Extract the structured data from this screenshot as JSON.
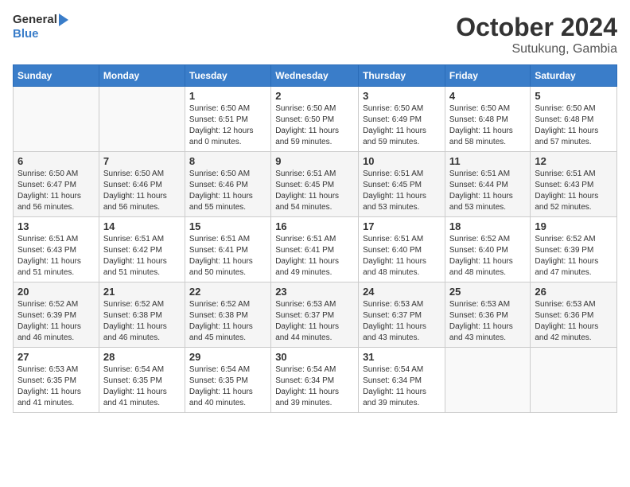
{
  "header": {
    "logo_general": "General",
    "logo_blue": "Blue",
    "month": "October 2024",
    "location": "Sutukung, Gambia"
  },
  "days_of_week": [
    "Sunday",
    "Monday",
    "Tuesday",
    "Wednesday",
    "Thursday",
    "Friday",
    "Saturday"
  ],
  "weeks": [
    [
      {
        "day": "",
        "info": ""
      },
      {
        "day": "",
        "info": ""
      },
      {
        "day": "1",
        "info": "Sunrise: 6:50 AM\nSunset: 6:51 PM\nDaylight: 12 hours\nand 0 minutes."
      },
      {
        "day": "2",
        "info": "Sunrise: 6:50 AM\nSunset: 6:50 PM\nDaylight: 11 hours\nand 59 minutes."
      },
      {
        "day": "3",
        "info": "Sunrise: 6:50 AM\nSunset: 6:49 PM\nDaylight: 11 hours\nand 59 minutes."
      },
      {
        "day": "4",
        "info": "Sunrise: 6:50 AM\nSunset: 6:48 PM\nDaylight: 11 hours\nand 58 minutes."
      },
      {
        "day": "5",
        "info": "Sunrise: 6:50 AM\nSunset: 6:48 PM\nDaylight: 11 hours\nand 57 minutes."
      }
    ],
    [
      {
        "day": "6",
        "info": "Sunrise: 6:50 AM\nSunset: 6:47 PM\nDaylight: 11 hours\nand 56 minutes."
      },
      {
        "day": "7",
        "info": "Sunrise: 6:50 AM\nSunset: 6:46 PM\nDaylight: 11 hours\nand 56 minutes."
      },
      {
        "day": "8",
        "info": "Sunrise: 6:50 AM\nSunset: 6:46 PM\nDaylight: 11 hours\nand 55 minutes."
      },
      {
        "day": "9",
        "info": "Sunrise: 6:51 AM\nSunset: 6:45 PM\nDaylight: 11 hours\nand 54 minutes."
      },
      {
        "day": "10",
        "info": "Sunrise: 6:51 AM\nSunset: 6:45 PM\nDaylight: 11 hours\nand 53 minutes."
      },
      {
        "day": "11",
        "info": "Sunrise: 6:51 AM\nSunset: 6:44 PM\nDaylight: 11 hours\nand 53 minutes."
      },
      {
        "day": "12",
        "info": "Sunrise: 6:51 AM\nSunset: 6:43 PM\nDaylight: 11 hours\nand 52 minutes."
      }
    ],
    [
      {
        "day": "13",
        "info": "Sunrise: 6:51 AM\nSunset: 6:43 PM\nDaylight: 11 hours\nand 51 minutes."
      },
      {
        "day": "14",
        "info": "Sunrise: 6:51 AM\nSunset: 6:42 PM\nDaylight: 11 hours\nand 51 minutes."
      },
      {
        "day": "15",
        "info": "Sunrise: 6:51 AM\nSunset: 6:41 PM\nDaylight: 11 hours\nand 50 minutes."
      },
      {
        "day": "16",
        "info": "Sunrise: 6:51 AM\nSunset: 6:41 PM\nDaylight: 11 hours\nand 49 minutes."
      },
      {
        "day": "17",
        "info": "Sunrise: 6:51 AM\nSunset: 6:40 PM\nDaylight: 11 hours\nand 48 minutes."
      },
      {
        "day": "18",
        "info": "Sunrise: 6:52 AM\nSunset: 6:40 PM\nDaylight: 11 hours\nand 48 minutes."
      },
      {
        "day": "19",
        "info": "Sunrise: 6:52 AM\nSunset: 6:39 PM\nDaylight: 11 hours\nand 47 minutes."
      }
    ],
    [
      {
        "day": "20",
        "info": "Sunrise: 6:52 AM\nSunset: 6:39 PM\nDaylight: 11 hours\nand 46 minutes."
      },
      {
        "day": "21",
        "info": "Sunrise: 6:52 AM\nSunset: 6:38 PM\nDaylight: 11 hours\nand 46 minutes."
      },
      {
        "day": "22",
        "info": "Sunrise: 6:52 AM\nSunset: 6:38 PM\nDaylight: 11 hours\nand 45 minutes."
      },
      {
        "day": "23",
        "info": "Sunrise: 6:53 AM\nSunset: 6:37 PM\nDaylight: 11 hours\nand 44 minutes."
      },
      {
        "day": "24",
        "info": "Sunrise: 6:53 AM\nSunset: 6:37 PM\nDaylight: 11 hours\nand 43 minutes."
      },
      {
        "day": "25",
        "info": "Sunrise: 6:53 AM\nSunset: 6:36 PM\nDaylight: 11 hours\nand 43 minutes."
      },
      {
        "day": "26",
        "info": "Sunrise: 6:53 AM\nSunset: 6:36 PM\nDaylight: 11 hours\nand 42 minutes."
      }
    ],
    [
      {
        "day": "27",
        "info": "Sunrise: 6:53 AM\nSunset: 6:35 PM\nDaylight: 11 hours\nand 41 minutes."
      },
      {
        "day": "28",
        "info": "Sunrise: 6:54 AM\nSunset: 6:35 PM\nDaylight: 11 hours\nand 41 minutes."
      },
      {
        "day": "29",
        "info": "Sunrise: 6:54 AM\nSunset: 6:35 PM\nDaylight: 11 hours\nand 40 minutes."
      },
      {
        "day": "30",
        "info": "Sunrise: 6:54 AM\nSunset: 6:34 PM\nDaylight: 11 hours\nand 39 minutes."
      },
      {
        "day": "31",
        "info": "Sunrise: 6:54 AM\nSunset: 6:34 PM\nDaylight: 11 hours\nand 39 minutes."
      },
      {
        "day": "",
        "info": ""
      },
      {
        "day": "",
        "info": ""
      }
    ]
  ]
}
